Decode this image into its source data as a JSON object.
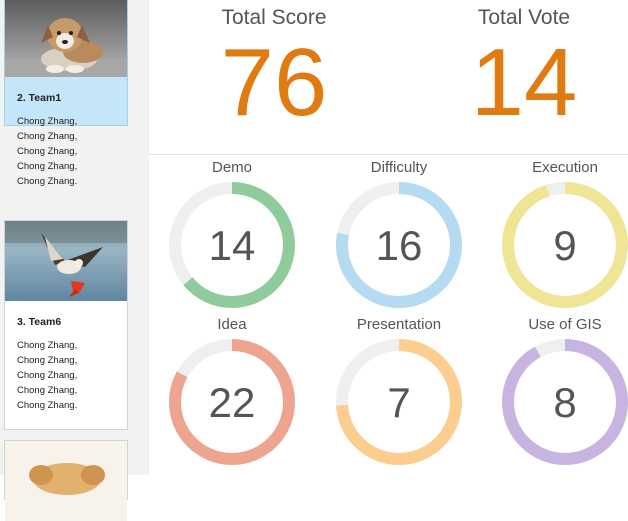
{
  "sidebar": {
    "cards": [
      {
        "name": "2. Team1",
        "members": [
          "Chong Zhang,",
          "Chong Zhang,",
          "Chong Zhang,",
          "Chong Zhang,",
          "Chong Zhang."
        ],
        "selected": true,
        "image": "puppy-photo"
      },
      {
        "name": "3. Team6",
        "members": [
          "Chong Zhang,",
          "Chong Zhang,",
          "Chong Zhang,",
          "Chong Zhang,",
          "Chong Zhang."
        ],
        "selected": false,
        "image": "osprey-photo"
      },
      {
        "name": "",
        "members": [],
        "selected": false,
        "image": "dog-photo"
      }
    ]
  },
  "totals": {
    "score_label": "Total Score",
    "score_value": "76",
    "vote_label": "Total Vote",
    "vote_value": "14"
  },
  "gauges": [
    {
      "label": "Demo",
      "value": "14",
      "fill": 0.64,
      "color": "#8fcb9b"
    },
    {
      "label": "Difficulty",
      "value": "16",
      "fill": 0.78,
      "color": "#b4dbf2"
    },
    {
      "label": "Execution",
      "value": "9",
      "fill": 0.95,
      "color": "#efe595"
    },
    {
      "label": "Idea",
      "value": "22",
      "fill": 0.83,
      "color": "#eea590"
    },
    {
      "label": "Presentation",
      "value": "7",
      "fill": 0.74,
      "color": "#fbcd8e"
    },
    {
      "label": "Use of GIS",
      "value": "8",
      "fill": 0.92,
      "color": "#c8b4e0"
    }
  ],
  "colors": {
    "accent": "#e07b12",
    "selected_card": "#c5e5f8",
    "gauge_track": "#efefef"
  }
}
